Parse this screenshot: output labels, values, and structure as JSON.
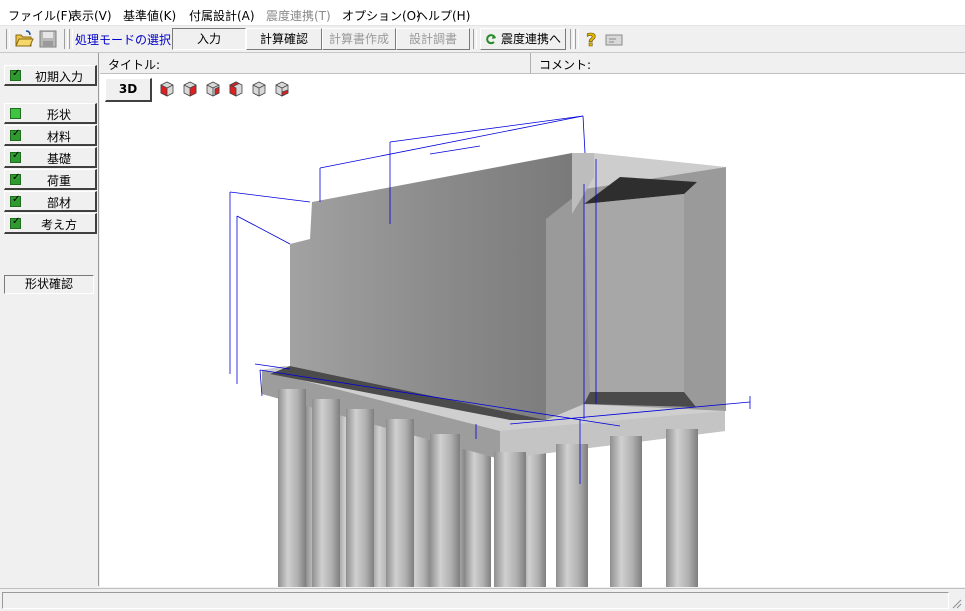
{
  "menu": {
    "items": [
      {
        "label": "ファイル(F)",
        "enabled": true
      },
      {
        "label": "表示(V)",
        "enabled": true
      },
      {
        "label": "基準値(K)",
        "enabled": true
      },
      {
        "label": "付属設計(A)",
        "enabled": true
      },
      {
        "label": "震度連携(T)",
        "enabled": false
      },
      {
        "label": "オプション(O)",
        "enabled": true
      },
      {
        "label": "ヘルプ(H)",
        "enabled": true
      }
    ]
  },
  "toolbar": {
    "mode_label": "処理モードの選択",
    "mode_current": "入力",
    "calc_confirm": "計算確認",
    "report_create": "計算書作成",
    "design_report": "設計調書",
    "seismic_link": "震度連携へ",
    "icons": [
      "open-folder-icon",
      "save-icon",
      "help-icon",
      "card-icon"
    ]
  },
  "sidebar": {
    "initial_input": "初期入力",
    "items": [
      {
        "label": "形状",
        "state": "green"
      },
      {
        "label": "材料",
        "state": "checked"
      },
      {
        "label": "基礎",
        "state": "checked"
      },
      {
        "label": "荷重",
        "state": "checked"
      },
      {
        "label": "部材",
        "state": "checked"
      },
      {
        "label": "考え方",
        "state": "checked"
      }
    ],
    "shape_confirm": "形状確認"
  },
  "info": {
    "title_label": "タイトル:",
    "comment_label": "コメント:"
  },
  "view": {
    "mode_3d": "3D",
    "view_buttons": [
      "view-front-icon",
      "view-back-icon",
      "view-left-icon",
      "view-right-icon",
      "view-top-icon",
      "view-bottom-icon"
    ]
  },
  "colors": {
    "accent_text": "#0000cc",
    "dimension_lines": "#0000dd",
    "check_green": "#2f9a2f"
  }
}
